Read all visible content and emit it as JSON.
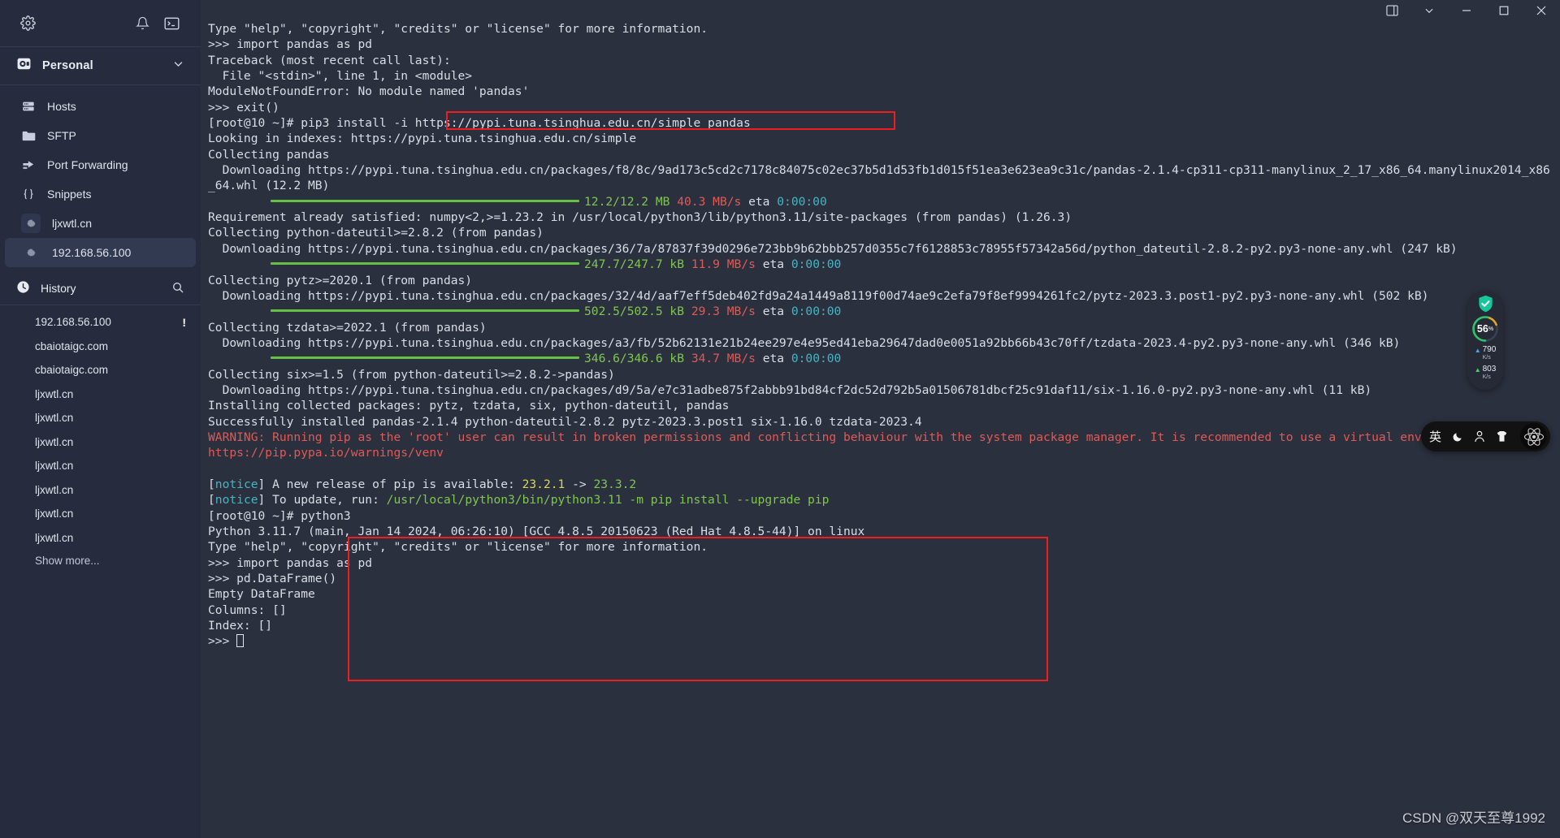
{
  "window": {
    "buttons": [
      {
        "name": "layout-panel",
        "glyph": "panel"
      },
      {
        "name": "chevron-down",
        "glyph": "chevron"
      },
      {
        "name": "minimize",
        "glyph": "minimize"
      },
      {
        "name": "maximize",
        "glyph": "maximize"
      },
      {
        "name": "close",
        "glyph": "close"
      }
    ]
  },
  "sidebar": {
    "top_icons": [
      {
        "name": "settings-gear-icon",
        "label": "Settings"
      },
      {
        "name": "bell-icon",
        "label": "Notifications"
      },
      {
        "name": "terminal-icon",
        "label": "New terminal"
      }
    ],
    "vault": {
      "label": "Personal"
    },
    "nav": [
      {
        "label": "Hosts",
        "icon": "server-icon"
      },
      {
        "label": "SFTP",
        "icon": "folder-icon"
      },
      {
        "label": "Port Forwarding",
        "icon": "forward-arrow-icon"
      },
      {
        "label": "Snippets",
        "icon": "braces-icon"
      }
    ],
    "hosts": [
      {
        "label": "ljxwtl.cn",
        "icon": "gear-host-icon",
        "selected": false
      },
      {
        "label": "192.168.56.100",
        "icon": "gear-host-icon",
        "selected": true
      }
    ],
    "history": {
      "label": "History",
      "search_icon": "search-icon",
      "items": [
        {
          "label": "192.168.56.100",
          "badge": "!"
        },
        {
          "label": "cbaiotaigc.com",
          "badge": ""
        },
        {
          "label": "cbaiotaigc.com",
          "badge": ""
        },
        {
          "label": "ljxwtl.cn",
          "badge": ""
        },
        {
          "label": "ljxwtl.cn",
          "badge": ""
        },
        {
          "label": "ljxwtl.cn",
          "badge": ""
        },
        {
          "label": "ljxwtl.cn",
          "badge": ""
        },
        {
          "label": "ljxwtl.cn",
          "badge": ""
        },
        {
          "label": "ljxwtl.cn",
          "badge": ""
        },
        {
          "label": "ljxwtl.cn",
          "badge": ""
        }
      ],
      "show_more": "Show more..."
    }
  },
  "terminal": {
    "lines": [
      [
        {
          "t": "Type \"help\", \"copyright\", \"credits\" or \"license\" for more information.",
          "c": "grey"
        }
      ],
      [
        {
          "t": ">>> import pandas as pd",
          "c": "grey"
        }
      ],
      [
        {
          "t": "Traceback (most recent call last):",
          "c": "grey"
        }
      ],
      [
        {
          "t": "  File \"<stdin>\", line 1, in <module>",
          "c": "grey"
        }
      ],
      [
        {
          "t": "ModuleNotFoundError: No module named 'pandas'",
          "c": "grey"
        }
      ],
      [
        {
          "t": ">>> exit()",
          "c": "grey"
        }
      ],
      [
        {
          "t": "[root@10 ~]# pip3 install -i https://pypi.tuna.tsinghua.edu.cn/simple pandas",
          "c": "grey"
        }
      ],
      [
        {
          "t": "Looking in indexes: https://pypi.tuna.tsinghua.edu.cn/simple",
          "c": "grey"
        }
      ],
      [
        {
          "t": "Collecting pandas",
          "c": "grey"
        }
      ],
      [
        {
          "t": "  Downloading https://pypi.tuna.tsinghua.edu.cn/packages/f8/8c/9ad173c5cd2c7178c84075c02ec37b5d1d53fb1d015f51ea3e623ea9c31c/pandas-2.1.4-cp311-cp311-manylinux_2_17_x86_64.manylinux2014_x86_64.whl (12.2 MB)",
          "c": "grey"
        }
      ],
      [
        {
          "bar": 380
        },
        {
          "t": "12.2/12.2 MB",
          "c": "green"
        },
        {
          "t": " ",
          "c": "grey"
        },
        {
          "t": "40.3 MB/s",
          "c": "red"
        },
        {
          "t": " ",
          "c": "grey"
        },
        {
          "t": "eta",
          "c": "grey"
        },
        {
          "t": " 0:00:00",
          "c": "cyan"
        }
      ],
      [
        {
          "t": "Requirement already satisfied: numpy<2,>=1.23.2 in /usr/local/python3/lib/python3.11/site-packages (from pandas) (1.26.3)",
          "c": "grey"
        }
      ],
      [
        {
          "t": "Collecting python-dateutil>=2.8.2 (from pandas)",
          "c": "grey"
        }
      ],
      [
        {
          "t": "  Downloading https://pypi.tuna.tsinghua.edu.cn/packages/36/7a/87837f39d0296e723bb9b62bbb257d0355c7f6128853c78955f57342a56d/python_dateutil-2.8.2-py2.py3-none-any.whl (247 kB)",
          "c": "grey"
        }
      ],
      [
        {
          "bar": 380
        },
        {
          "t": "247.7/247.7 kB",
          "c": "green"
        },
        {
          "t": " ",
          "c": "grey"
        },
        {
          "t": "11.9 MB/s",
          "c": "red"
        },
        {
          "t": " ",
          "c": "grey"
        },
        {
          "t": "eta",
          "c": "grey"
        },
        {
          "t": " 0:00:00",
          "c": "cyan"
        }
      ],
      [
        {
          "t": "Collecting pytz>=2020.1 (from pandas)",
          "c": "grey"
        }
      ],
      [
        {
          "t": "  Downloading https://pypi.tuna.tsinghua.edu.cn/packages/32/4d/aaf7eff5deb402fd9a24a1449a8119f00d74ae9c2efa79f8ef9994261fc2/pytz-2023.3.post1-py2.py3-none-any.whl (502 kB)",
          "c": "grey"
        }
      ],
      [
        {
          "bar": 380
        },
        {
          "t": "502.5/502.5 kB",
          "c": "green"
        },
        {
          "t": " ",
          "c": "grey"
        },
        {
          "t": "29.3 MB/s",
          "c": "red"
        },
        {
          "t": " ",
          "c": "grey"
        },
        {
          "t": "eta",
          "c": "grey"
        },
        {
          "t": " 0:00:00",
          "c": "cyan"
        }
      ],
      [
        {
          "t": "Collecting tzdata>=2022.1 (from pandas)",
          "c": "grey"
        }
      ],
      [
        {
          "t": "  Downloading https://pypi.tuna.tsinghua.edu.cn/packages/a3/fb/52b62131e21b24ee297e4e95ed41eba29647dad0e0051a92bb66b43c70ff/tzdata-2023.4-py2.py3-none-any.whl (346 kB)",
          "c": "grey"
        }
      ],
      [
        {
          "bar": 380
        },
        {
          "t": "346.6/346.6 kB",
          "c": "green"
        },
        {
          "t": " ",
          "c": "grey"
        },
        {
          "t": "34.7 MB/s",
          "c": "red"
        },
        {
          "t": " ",
          "c": "grey"
        },
        {
          "t": "eta",
          "c": "grey"
        },
        {
          "t": " 0:00:00",
          "c": "cyan"
        }
      ],
      [
        {
          "t": "Collecting six>=1.5 (from python-dateutil>=2.8.2->pandas)",
          "c": "grey"
        }
      ],
      [
        {
          "t": "  Downloading https://pypi.tuna.tsinghua.edu.cn/packages/d9/5a/e7c31adbe875f2abbb91bd84cf2dc52d792b5a01506781dbcf25c91daf11/six-1.16.0-py2.py3-none-any.whl (11 kB)",
          "c": "grey"
        }
      ],
      [
        {
          "t": "Installing collected packages: pytz, tzdata, six, python-dateutil, pandas",
          "c": "grey"
        }
      ],
      [
        {
          "t": "Successfully installed pandas-2.1.4 python-dateutil-2.8.2 pytz-2023.3.post1 six-1.16.0 tzdata-2023.4",
          "c": "grey"
        }
      ],
      [
        {
          "t": "WARNING: Running pip as the 'root' user can result in broken permissions and conflicting behaviour with the system package manager. It is recommended to use a virtual environment instead: https://pip.pypa.io/warnings/venv",
          "c": "red"
        }
      ],
      [
        {
          "t": "",
          "c": "grey"
        }
      ],
      [
        {
          "t": "[",
          "c": "grey"
        },
        {
          "t": "notice",
          "c": "cyan"
        },
        {
          "t": "] A new release of pip is available: ",
          "c": "grey"
        },
        {
          "t": "23.2.1",
          "c": "yellow"
        },
        {
          "t": " -> ",
          "c": "grey"
        },
        {
          "t": "23.3.2",
          "c": "green"
        }
      ],
      [
        {
          "t": "[",
          "c": "grey"
        },
        {
          "t": "notice",
          "c": "cyan"
        },
        {
          "t": "] To update, run: ",
          "c": "grey"
        },
        {
          "t": "/usr/local/python3/bin/python3.11 -m pip install --upgrade pip",
          "c": "green"
        }
      ],
      [
        {
          "t": "[root@10 ~]# python3",
          "c": "grey"
        }
      ],
      [
        {
          "t": "Python 3.11.7 (main, Jan 14 2024, 06:26:10) [GCC 4.8.5 20150623 (Red Hat 4.8.5-44)] on linux",
          "c": "grey"
        }
      ],
      [
        {
          "t": "Type \"help\", \"copyright\", \"credits\" or \"license\" for more information.",
          "c": "grey"
        }
      ],
      [
        {
          "t": ">>> import pandas as pd",
          "c": "grey"
        }
      ],
      [
        {
          "t": ">>> pd.DataFrame()",
          "c": "grey"
        }
      ],
      [
        {
          "t": "Empty DataFrame",
          "c": "grey"
        }
      ],
      [
        {
          "t": "Columns: []",
          "c": "grey"
        }
      ],
      [
        {
          "t": "Index: []",
          "c": "grey"
        }
      ],
      [
        {
          "t": ">>> ",
          "c": "grey"
        },
        {
          "cursor": true
        }
      ]
    ]
  },
  "net_widget": {
    "shield_icon": "shield-check-icon",
    "percent": "56",
    "percent_unit": "%",
    "upload": {
      "value": "790",
      "unit": "K/s"
    },
    "download": {
      "value": "803",
      "unit": "K/s"
    }
  },
  "ime_bar": {
    "items": [
      {
        "name": "ime-language-button",
        "label": "英"
      },
      {
        "name": "ime-moon-icon",
        "label": "☾"
      },
      {
        "name": "ime-user-icon",
        "label": "user"
      },
      {
        "name": "ime-skin-icon",
        "label": "shirt"
      },
      {
        "name": "ime-logo-icon",
        "label": "atom"
      }
    ]
  },
  "watermark": "CSDN @双天至尊1992",
  "colors": {
    "sidebar_bg": "#262c3e",
    "terminal_bg": "#2b303e",
    "accent_red": "#ef1d22",
    "progress_green": "#66c042"
  }
}
